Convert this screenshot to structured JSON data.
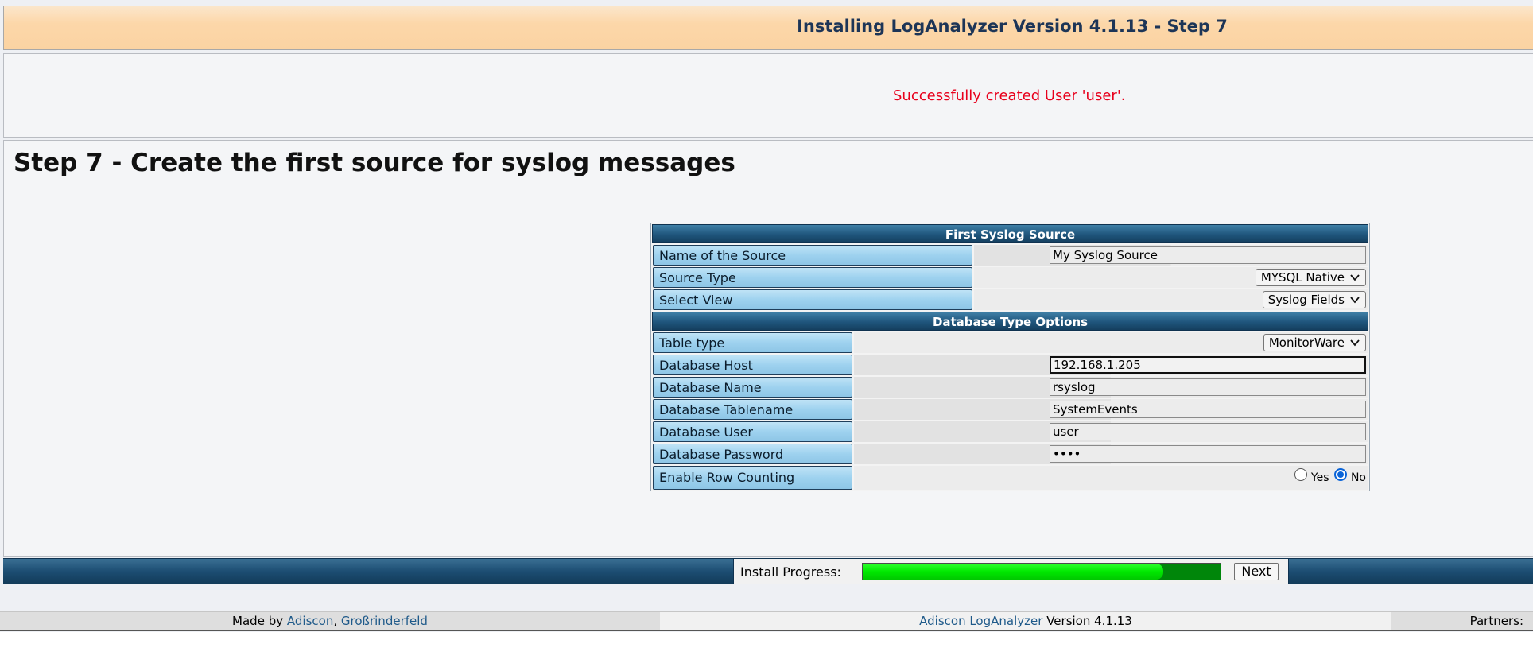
{
  "header": {
    "title": "Installing LogAnalyzer Version 4.1.13 - Step 7"
  },
  "message": {
    "text": "Successfully created User 'user'."
  },
  "page": {
    "step_title": "Step 7 - Create the first source for syslog messages"
  },
  "form": {
    "section1_title": "First Syslog Source",
    "source_name": {
      "label": "Name of the Source",
      "value": "My Syslog Source"
    },
    "source_type": {
      "label": "Source Type",
      "selected": "MYSQL Native"
    },
    "select_view": {
      "label": "Select View",
      "selected": "Syslog Fields"
    },
    "section2_title": "Database Type Options",
    "table_type": {
      "label": "Table type",
      "selected": "MonitorWare"
    },
    "db_host": {
      "label": "Database Host",
      "value": "192.168.1.205"
    },
    "db_name": {
      "label": "Database Name",
      "value": "rsyslog"
    },
    "db_tablename": {
      "label": "Database Tablename",
      "value": "SystemEvents"
    },
    "db_user": {
      "label": "Database User",
      "value": "user"
    },
    "db_password": {
      "label": "Database Password",
      "value": "••••"
    },
    "row_counting": {
      "label": "Enable Row Counting",
      "yes_label": "Yes",
      "no_label": "No",
      "selected": "No"
    }
  },
  "progress": {
    "label": "Install Progress:",
    "fraction": 0.84,
    "next_label": "Next"
  },
  "footer": {
    "made_by": "Made by",
    "company": "Adiscon",
    "separator": ",",
    "location": "Großrinderfeld",
    "product": "Adiscon LogAnalyzer",
    "version": "Version 4.1.13",
    "partners": "Partners:"
  },
  "colors": {
    "accent": "#1f557c",
    "success": "#e8001c",
    "progress": "#00e800",
    "header_bg": "#fcd7a9"
  },
  "icons": {
    "select_arrow": "chevron-down-icon"
  }
}
